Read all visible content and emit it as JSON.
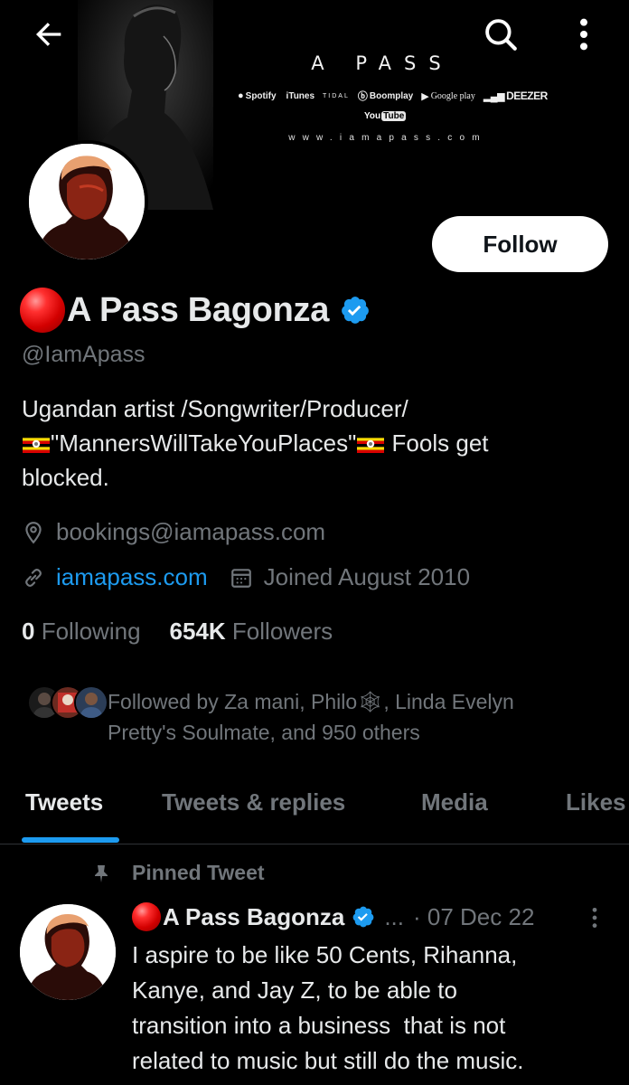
{
  "header": {
    "banner": {
      "artist_title": "A PASS",
      "platforms": [
        "Spotify",
        "iTunes",
        "TIDAL",
        "Boomplay",
        "Google play",
        "DEEZER"
      ],
      "youtube_left": "You",
      "youtube_right": "Tube",
      "website": "www.iamapass.com"
    },
    "back_icon": "arrow-left-icon",
    "search_icon": "search-icon",
    "more_icon": "more-vertical-icon"
  },
  "profile": {
    "follow_label": "Follow",
    "display_name": "A Pass Bagonza",
    "handle": "@IamApass",
    "bio_line1": "Ugandan artist /Songwriter/Producer/",
    "bio_line2_quote": "\"MannersWillTakeYouPlaces\"",
    "bio_line2_tail": " Fools get",
    "bio_line3": "blocked.",
    "location": "bookings@iamapass.com",
    "website": "iamapass.com",
    "joined": "Joined August 2010",
    "following_count": "0",
    "following_label": "Following",
    "followers_count": "654K",
    "followers_label": "Followers",
    "followed_by_line1": "Followed by Za mani, Philo🕸, Linda Evelyn",
    "followed_by_line2": "Pretty's Soulmate, and 950 others"
  },
  "tabs": [
    {
      "label": "Tweets",
      "active": true
    },
    {
      "label": "Tweets & replies",
      "active": false
    },
    {
      "label": "Media",
      "active": false
    },
    {
      "label": "Likes",
      "active": false
    }
  ],
  "pinned_tweet": {
    "pinned_label": "Pinned Tweet",
    "name": "A Pass Bagonza",
    "handle_truncated": "...",
    "date": "· 07 Dec 22",
    "text_lines": [
      "I aspire to be like 50 Cents, Rihanna,",
      "Kanye, and Jay Z, to be able to",
      "transition into a business  that is not",
      "related to music but still do the music."
    ]
  },
  "colors": {
    "background": "#000000",
    "text_primary": "#e7e9ea",
    "text_secondary": "#71767b",
    "accent": "#1d9bf0",
    "divider": "#2f3336"
  }
}
